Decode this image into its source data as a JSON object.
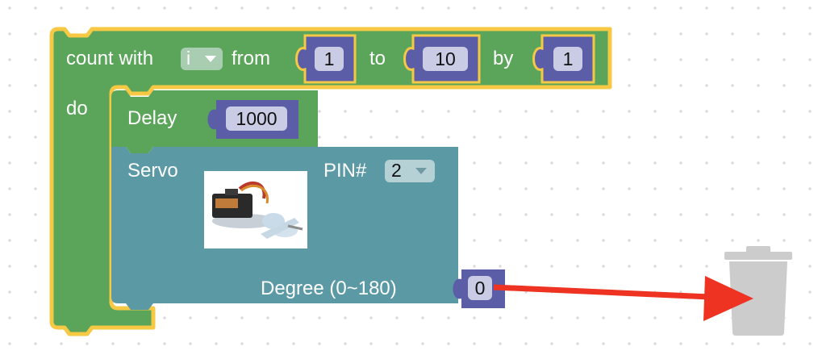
{
  "loop_block": {
    "label_count_with": "count with",
    "variable": "i",
    "label_from": "from",
    "from_value": "1",
    "label_to": "to",
    "to_value": "10",
    "label_by": "by",
    "by_value": "1",
    "label_do": "do"
  },
  "delay_block": {
    "label": "Delay",
    "value": "1000"
  },
  "servo_block": {
    "label": "Servo",
    "pin_label": "PIN#",
    "pin_value": "2",
    "degree_label": "Degree (0~180)",
    "degree_value": "0"
  },
  "colors": {
    "loop_green": "#5ba55b",
    "highlight_yellow": "#f6c843",
    "value_block": "#5b5ea6",
    "servo_teal": "#5b9aa5",
    "arrow_red": "#ee3322",
    "trash_gray": "#cccccc"
  },
  "icons": {
    "trash": "trash-can-icon",
    "arrow": "red-arrow-annotation",
    "servo_picture": "servo-motor-image"
  }
}
